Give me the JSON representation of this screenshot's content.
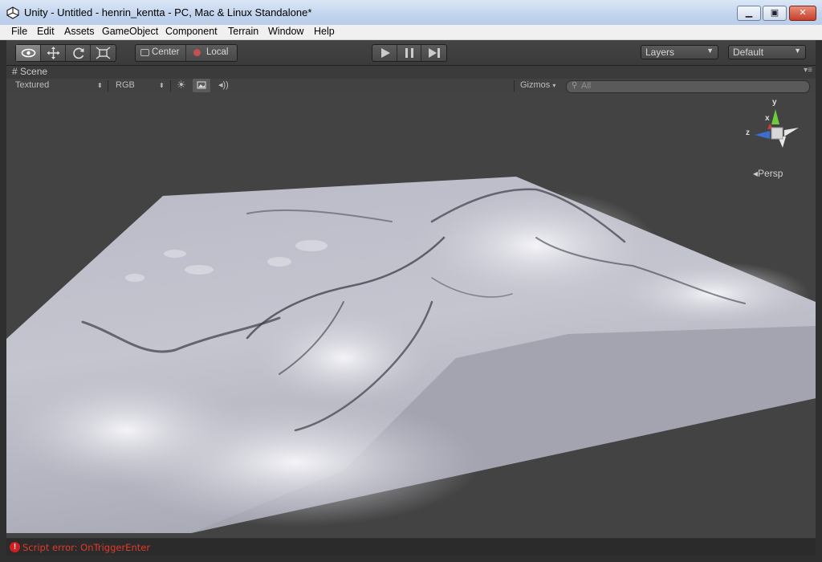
{
  "window": {
    "title": "Unity - Untitled - henrin_kentta - PC, Mac & Linux Standalone*"
  },
  "menu": [
    "File",
    "Edit",
    "Assets",
    "GameObject",
    "Component",
    "Terrain",
    "Window",
    "Help"
  ],
  "toolbar": {
    "pivot_label": "Center",
    "space_label": "Local",
    "layers_label": "Layers",
    "layout_label": "Default"
  },
  "scene": {
    "tab_label": "Scene",
    "render_mode": "Textured",
    "color_mode": "RGB",
    "gizmos_label": "Gizmos",
    "search_placeholder": "All",
    "persp_label": "Persp",
    "axis": {
      "x": "x",
      "y": "y",
      "z": "z"
    }
  },
  "status": {
    "message": "Script error: OnTriggerEnter"
  },
  "colors": {
    "accent_error": "#e23a2a",
    "axis_x": "#d43a3a",
    "axis_y": "#6ecb3c",
    "axis_z": "#3a6ed4"
  }
}
